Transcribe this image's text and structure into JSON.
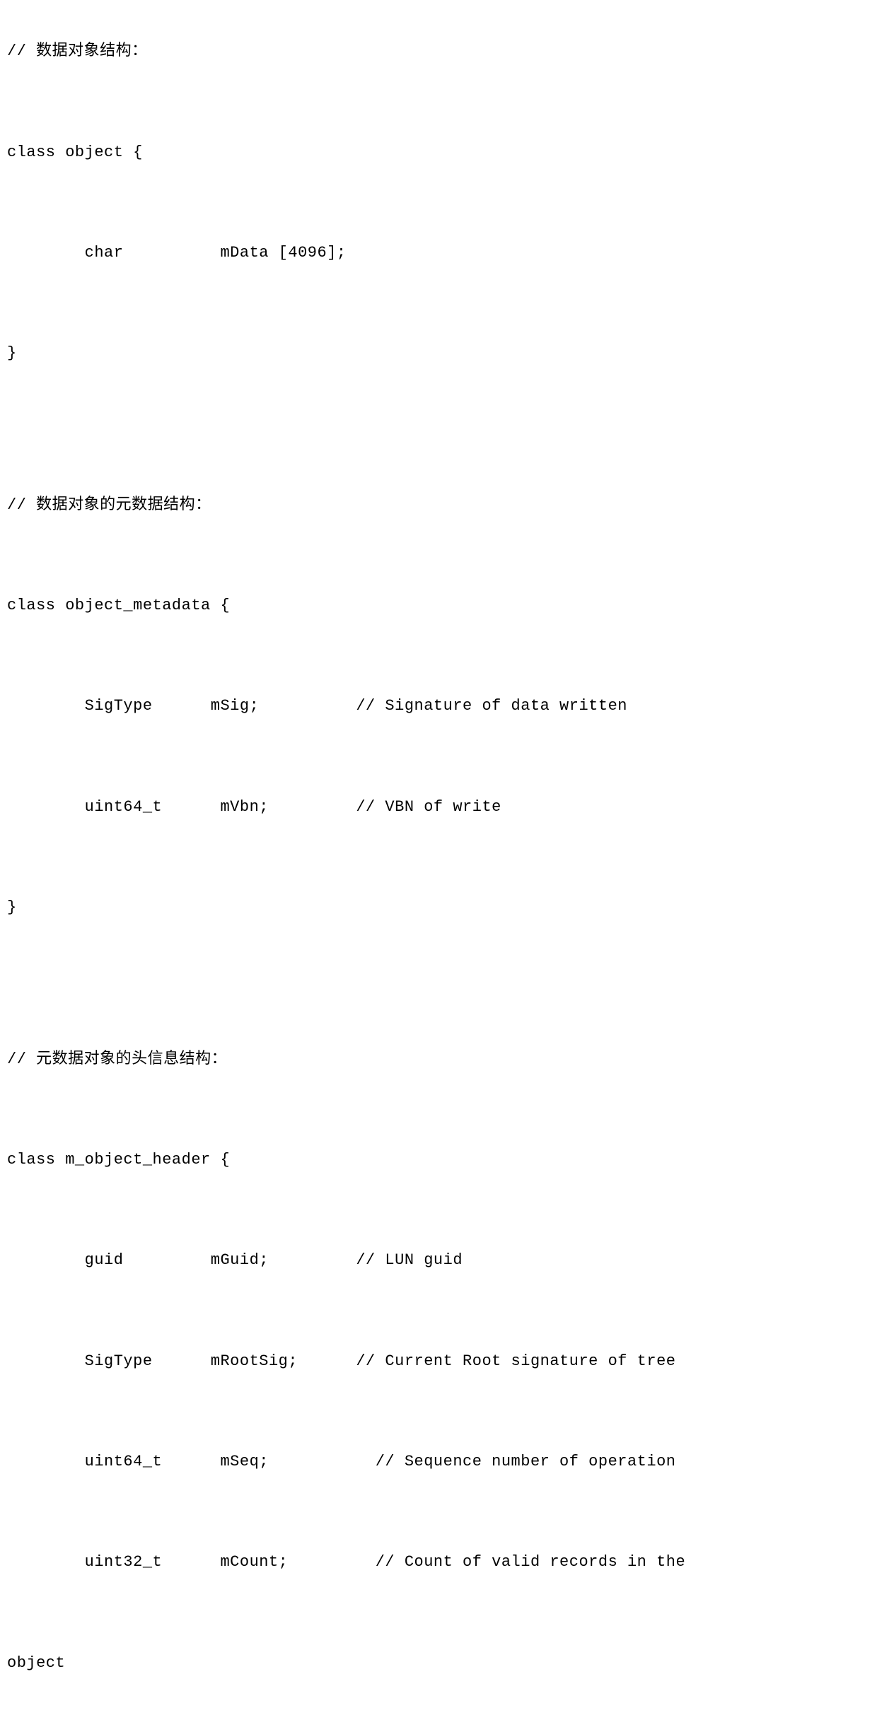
{
  "code": {
    "section1": {
      "comment": "// 数据对象结构：",
      "decl": "class object {",
      "member1_type": "char",
      "member1_name": "mData [4096];",
      "close": "}"
    },
    "section2": {
      "comment": "// 数据对象的元数据结构：",
      "decl": "class object_metadata {",
      "member1_type": "SigType",
      "member1_name": "mSig;",
      "member1_comment": "// Signature of data written",
      "member2_type": "uint64_t",
      "member2_name": "mVbn;",
      "member2_comment": "// VBN of write",
      "close": "}"
    },
    "section3": {
      "comment": "// 元数据对象的头信息结构：",
      "decl": "class m_object_header {",
      "member1_type": "guid",
      "member1_name": "mGuid;",
      "member1_comment": "// LUN guid",
      "member2_type": "SigType",
      "member2_name": "mRootSig;",
      "member2_comment": "// Current Root signature of tree",
      "member3_type": "uint64_t",
      "member3_name": "mSeq;",
      "member3_comment": "// Sequence number of operation",
      "member4_type": "uint32_t",
      "member4_name": "mCount;",
      "member4_comment": "// Count of valid records in the",
      "trailing": "object"
    }
  }
}
